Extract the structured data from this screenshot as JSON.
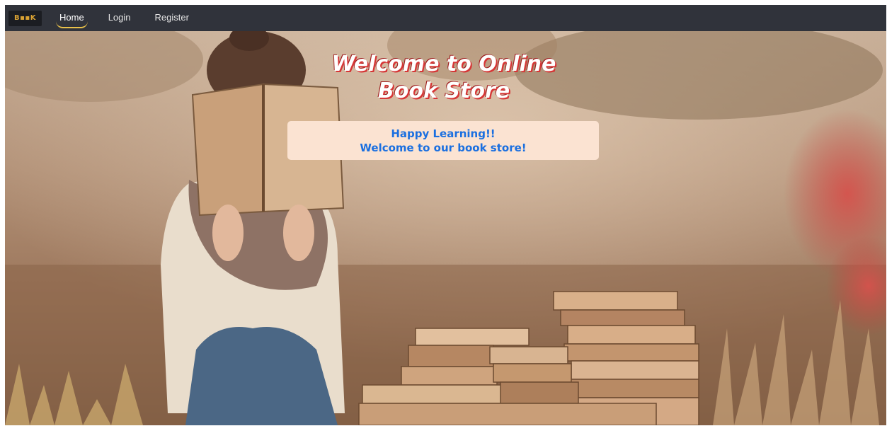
{
  "nav": {
    "logo_text": "B▪▪K",
    "items": [
      {
        "label": "Home",
        "active": true
      },
      {
        "label": "Login",
        "active": false
      },
      {
        "label": "Register",
        "active": false
      }
    ]
  },
  "hero": {
    "title_line1": "Welcome to Online",
    "title_line2": "Book Store",
    "message_line1": "Happy Learning!!",
    "message_line2": "Welcome to our book store!"
  },
  "colors": {
    "navbar_bg": "#30333b",
    "active_underline": "#e9c14a",
    "title_shadow": "#d63636",
    "message_bg": "#fbe3d2",
    "message_text": "#1a6fe0"
  }
}
